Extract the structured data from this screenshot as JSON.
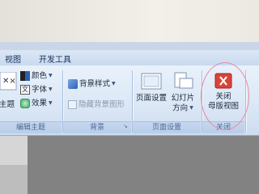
{
  "tabs": [
    {
      "label": "视图"
    },
    {
      "label": "开发工具"
    }
  ],
  "theme_group": {
    "colors_label": "颜色",
    "fonts_label": "字体",
    "effects_label": "效果",
    "themes_label": "主题",
    "group_label": "编辑主题"
  },
  "background_group": {
    "styles_label": "背景样式",
    "hide_graphics_label": "隐藏背景图形",
    "group_label": "背景"
  },
  "page_setup_group": {
    "page_setup_label": "页面设置",
    "orientation_label_1": "幻灯片",
    "orientation_label_2": "方向",
    "group_label": "页面设置"
  },
  "close_group": {
    "close_label_1": "关闭",
    "close_label_2": "母版视图",
    "group_label": "关闭"
  },
  "colors": {
    "accent_red": "#d9443a",
    "highlight_ring": "#e88aa6"
  }
}
